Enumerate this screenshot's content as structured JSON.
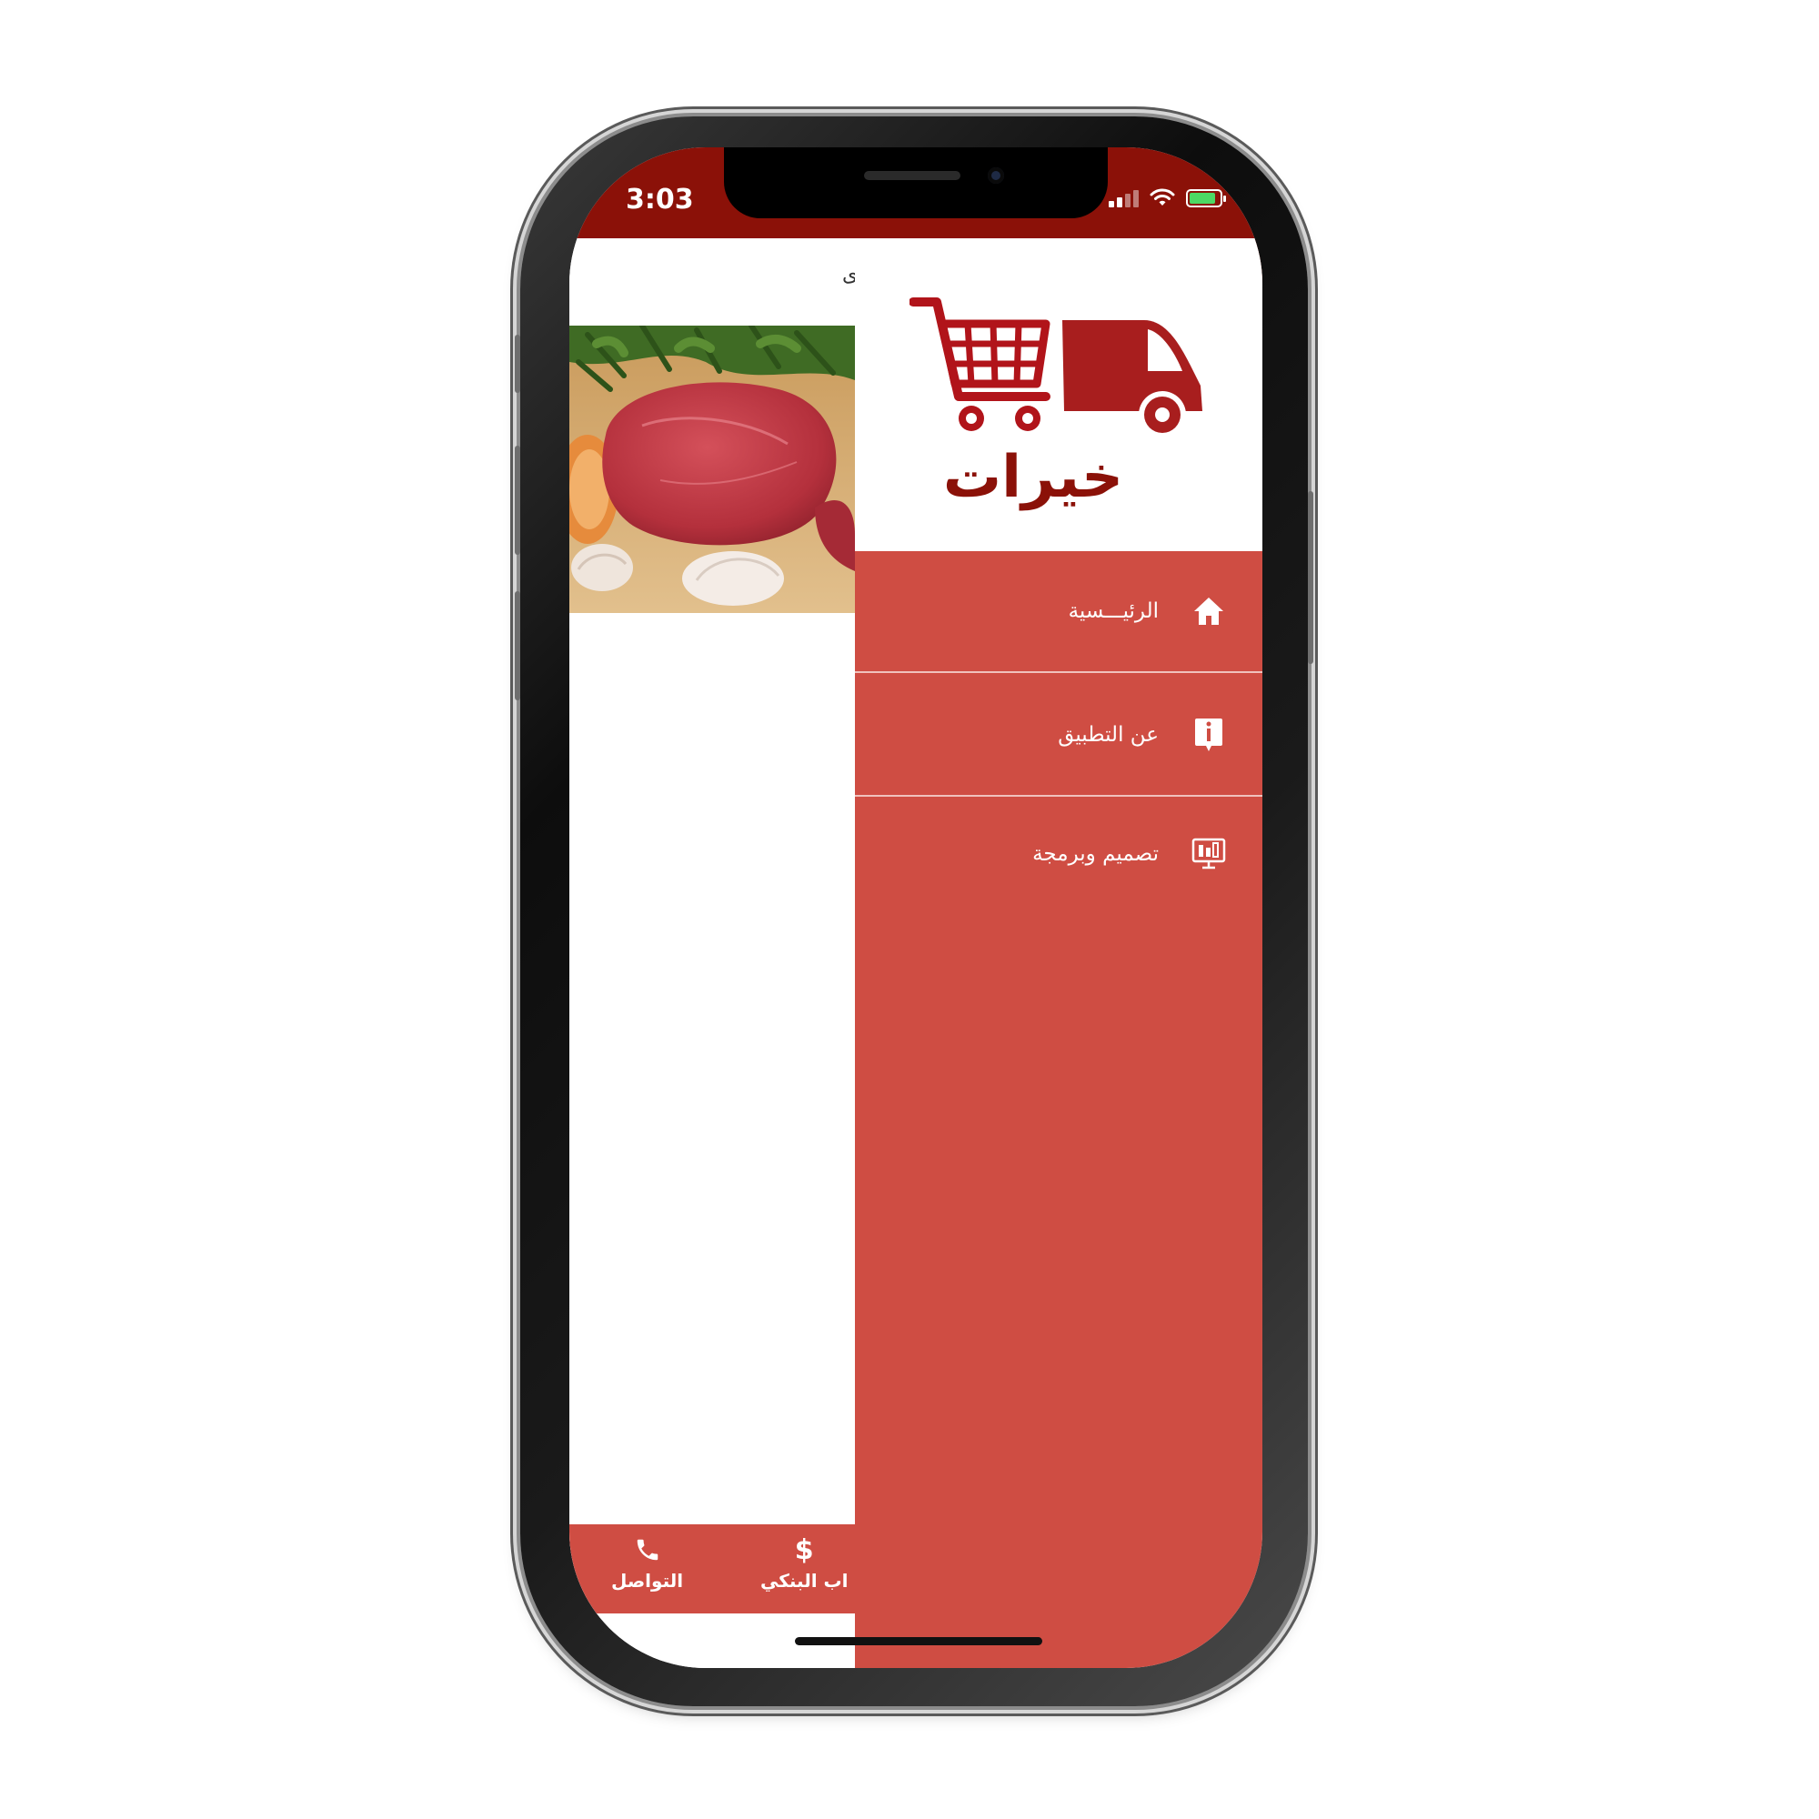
{
  "status_bar": {
    "time": "3:03",
    "icons": [
      "signal-icon",
      "wifi-icon",
      "battery-charging-icon"
    ],
    "color": "#8b1108"
  },
  "main": {
    "title_fragment": "ى",
    "image": "meat-product-image",
    "bottom_nav": {
      "items": [
        {
          "label": "التواصل",
          "icon": "phone-icon"
        },
        {
          "label": "اب البنكي",
          "icon": "dollar-icon"
        }
      ]
    }
  },
  "drawer": {
    "logo": {
      "text": "خيرات",
      "icon": "cart-truck-logo"
    },
    "items": [
      {
        "label": "الرئيـــسية",
        "icon": "home-icon"
      },
      {
        "label": "عن التطبيق",
        "icon": "info-icon"
      },
      {
        "label": "تصميم وبرمجة",
        "icon": "monitor-design-icon"
      }
    ],
    "color": "#cf4d43"
  },
  "colors": {
    "accent": "#cf4d43",
    "brand_dark": "#8b1108"
  }
}
